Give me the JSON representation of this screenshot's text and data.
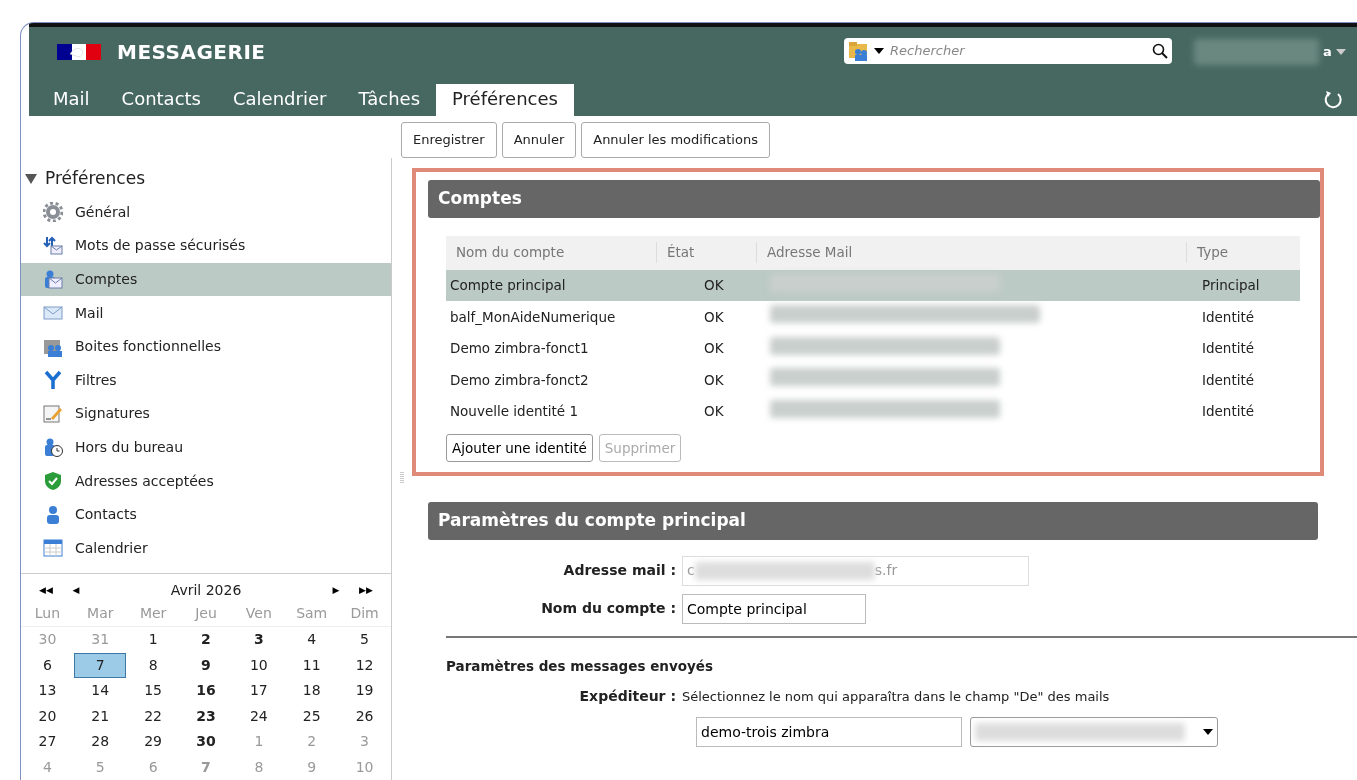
{
  "app": {
    "title": "MESSAGERIE",
    "search": {
      "placeholder": "Rechercher"
    },
    "user_suffix": "a"
  },
  "tabs": [
    {
      "label": "Mail",
      "selected": false
    },
    {
      "label": "Contacts",
      "selected": false
    },
    {
      "label": "Calendrier",
      "selected": false
    },
    {
      "label": "Tâches",
      "selected": false
    },
    {
      "label": "Préférences",
      "selected": true
    }
  ],
  "toolbar": [
    {
      "label": "Enregistrer"
    },
    {
      "label": "Annuler"
    },
    {
      "label": "Annuler les modifications"
    }
  ],
  "sidebar": {
    "title": "Préférences",
    "expanded": true,
    "items": [
      {
        "label": "Général",
        "selected": false
      },
      {
        "label": "Mots de passe sécurisés",
        "selected": false
      },
      {
        "label": "Comptes",
        "selected": true
      },
      {
        "label": "Mail",
        "selected": false
      },
      {
        "label": "Boites fonctionnelles",
        "selected": false
      },
      {
        "label": "Filtres",
        "selected": false
      },
      {
        "label": "Signatures",
        "selected": false
      },
      {
        "label": "Hors du bureau",
        "selected": false
      },
      {
        "label": "Adresses acceptées",
        "selected": false
      },
      {
        "label": "Contacts",
        "selected": false
      },
      {
        "label": "Calendrier",
        "selected": false
      }
    ]
  },
  "mini_calendar": {
    "month": "Avril 2026",
    "nav": [
      "◀◀",
      "◀",
      "▶",
      "▶▶"
    ],
    "weekdays": [
      "Lun",
      "Mar",
      "Mer",
      "Jeu",
      "Ven",
      "Sam",
      "Dim"
    ],
    "weeks": [
      [
        {
          "d": "30",
          "other": true,
          "bold": false,
          "selected": false
        },
        {
          "d": "31",
          "other": true,
          "bold": false,
          "selected": false
        },
        {
          "d": "1",
          "other": false,
          "bold": false,
          "selected": false
        },
        {
          "d": "2",
          "other": false,
          "bold": true,
          "selected": false
        },
        {
          "d": "3",
          "other": false,
          "bold": true,
          "selected": false
        },
        {
          "d": "4",
          "other": false,
          "bold": false,
          "selected": false
        },
        {
          "d": "5",
          "other": false,
          "bold": false,
          "selected": false
        }
      ],
      [
        {
          "d": "6",
          "other": false,
          "bold": false,
          "selected": false
        },
        {
          "d": "7",
          "other": false,
          "bold": false,
          "selected": true
        },
        {
          "d": "8",
          "other": false,
          "bold": false,
          "selected": false
        },
        {
          "d": "9",
          "other": false,
          "bold": true,
          "selected": false
        },
        {
          "d": "10",
          "other": false,
          "bold": false,
          "selected": false
        },
        {
          "d": "11",
          "other": false,
          "bold": false,
          "selected": false
        },
        {
          "d": "12",
          "other": false,
          "bold": false,
          "selected": false
        }
      ],
      [
        {
          "d": "13",
          "other": false,
          "bold": false,
          "selected": false
        },
        {
          "d": "14",
          "other": false,
          "bold": false,
          "selected": false
        },
        {
          "d": "15",
          "other": false,
          "bold": false,
          "selected": false
        },
        {
          "d": "16",
          "other": false,
          "bold": true,
          "selected": false
        },
        {
          "d": "17",
          "other": false,
          "bold": false,
          "selected": false
        },
        {
          "d": "18",
          "other": false,
          "bold": false,
          "selected": false
        },
        {
          "d": "19",
          "other": false,
          "bold": false,
          "selected": false
        }
      ],
      [
        {
          "d": "20",
          "other": false,
          "bold": false,
          "selected": false
        },
        {
          "d": "21",
          "other": false,
          "bold": false,
          "selected": false
        },
        {
          "d": "22",
          "other": false,
          "bold": false,
          "selected": false
        },
        {
          "d": "23",
          "other": false,
          "bold": true,
          "selected": false
        },
        {
          "d": "24",
          "other": false,
          "bold": false,
          "selected": false
        },
        {
          "d": "25",
          "other": false,
          "bold": false,
          "selected": false
        },
        {
          "d": "26",
          "other": false,
          "bold": false,
          "selected": false
        }
      ],
      [
        {
          "d": "27",
          "other": false,
          "bold": false,
          "selected": false
        },
        {
          "d": "28",
          "other": false,
          "bold": false,
          "selected": false
        },
        {
          "d": "29",
          "other": false,
          "bold": false,
          "selected": false
        },
        {
          "d": "30",
          "other": false,
          "bold": true,
          "selected": false
        },
        {
          "d": "1",
          "other": true,
          "bold": false,
          "selected": false
        },
        {
          "d": "2",
          "other": true,
          "bold": false,
          "selected": false
        },
        {
          "d": "3",
          "other": true,
          "bold": false,
          "selected": false
        }
      ],
      [
        {
          "d": "4",
          "other": true,
          "bold": false,
          "selected": false
        },
        {
          "d": "5",
          "other": true,
          "bold": false,
          "selected": false
        },
        {
          "d": "6",
          "other": true,
          "bold": false,
          "selected": false
        },
        {
          "d": "7",
          "other": true,
          "bold": true,
          "selected": false
        },
        {
          "d": "8",
          "other": true,
          "bold": false,
          "selected": false
        },
        {
          "d": "9",
          "other": true,
          "bold": false,
          "selected": false
        },
        {
          "d": "10",
          "other": true,
          "bold": false,
          "selected": false
        }
      ]
    ]
  },
  "accounts": {
    "title": "Comptes",
    "columns": [
      "Nom du compte",
      "État",
      "Adresse Mail",
      "Type"
    ],
    "rows": [
      {
        "name": "Compte principal",
        "state": "OK",
        "type": "Principal",
        "selected": true
      },
      {
        "name": "balf_MonAideNumerique",
        "state": "OK",
        "type": "Identité",
        "selected": false
      },
      {
        "name": "Demo zimbra-fonct1",
        "state": "OK",
        "type": "Identité",
        "selected": false
      },
      {
        "name": "Demo zimbra-fonct2",
        "state": "OK",
        "type": "Identité",
        "selected": false
      },
      {
        "name": "Nouvelle identité 1",
        "state": "OK",
        "type": "Identité",
        "selected": false
      }
    ],
    "buttons": [
      {
        "label": "Ajouter une identité",
        "disabled": false
      },
      {
        "label": "Supprimer",
        "disabled": true
      }
    ]
  },
  "settings": {
    "title": "Paramètres du compte principal",
    "address": {
      "label": "Adresse mail :",
      "prefix": "c",
      "suffix": "s.fr"
    },
    "account_name": {
      "label": "Nom du compte :",
      "value": "Compte principal"
    },
    "sent_title": "Paramètres des messages envoyés",
    "sender": {
      "label": "Expéditeur :",
      "hint": "Sélectionnez le nom qui apparaîtra dans le champ \"De\" des mails",
      "name_value": "demo-trois zimbra"
    }
  }
}
